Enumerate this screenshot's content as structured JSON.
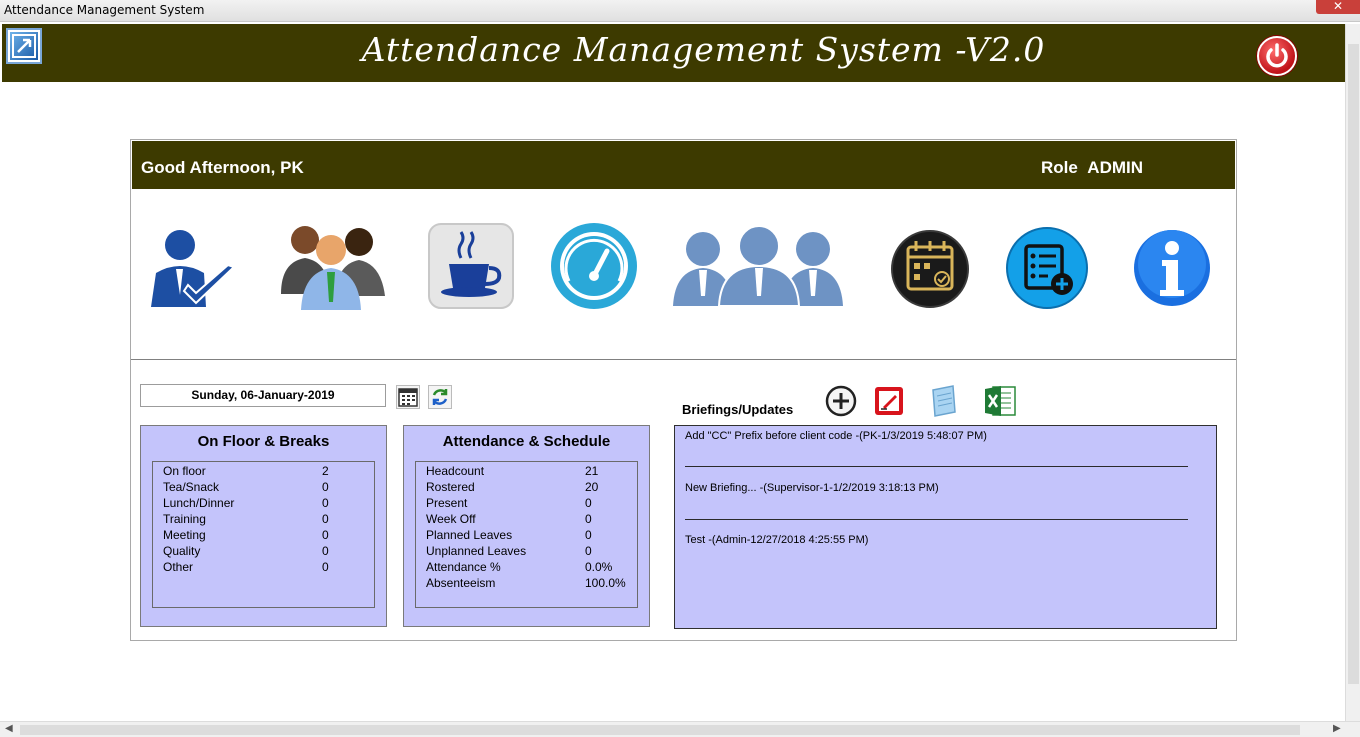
{
  "window": {
    "title": "Attendance Management System",
    "close_label": "✕"
  },
  "header": {
    "app_title": "Attendance Management System -V2.0"
  },
  "greeting_bar": {
    "greeting": "Good Afternoon, PK",
    "role_label": "Role",
    "role_value": "ADMIN"
  },
  "toolbar_icons": [
    "user-attendance-icon",
    "team-people-icon",
    "coffee-break-icon",
    "dashboard-gauge-icon",
    "employees-group-icon",
    "schedule-calendar-icon",
    "add-report-icon",
    "info-icon"
  ],
  "date": {
    "value": "Sunday,  06-January-2019"
  },
  "floor_breaks": {
    "title": "On Floor & Breaks",
    "rows": [
      {
        "label": "On floor",
        "value": "2"
      },
      {
        "label": "Tea/Snack",
        "value": "0"
      },
      {
        "label": "Lunch/Dinner",
        "value": "0"
      },
      {
        "label": "Training",
        "value": "0"
      },
      {
        "label": "Meeting",
        "value": "0"
      },
      {
        "label": "Quality",
        "value": "0"
      },
      {
        "label": "Other",
        "value": "0"
      }
    ]
  },
  "attendance_schedule": {
    "title": "Attendance & Schedule",
    "rows": [
      {
        "label": "Headcount",
        "value": "21"
      },
      {
        "label": "Rostered",
        "value": "20"
      },
      {
        "label": "Present",
        "value": "0"
      },
      {
        "label": "Week Off",
        "value": "0"
      },
      {
        "label": "Planned Leaves",
        "value": "0"
      },
      {
        "label": "Unplanned Leaves",
        "value": "0"
      },
      {
        "label": "Attendance %",
        "value": "0.0%"
      },
      {
        "label": "Absenteeism",
        "value": "100.0%"
      }
    ]
  },
  "briefings": {
    "label": "Briefings/Updates",
    "items": [
      "Add \"CC\" Prefix before client code  -(PK-1/3/2019 5:48:07 PM)",
      "New Briefing...  -(Supervisor-1-1/2/2019 3:18:13 PM)",
      "Test  -(Admin-12/27/2018 4:25:55 PM)"
    ]
  },
  "colors": {
    "header_bg": "#3d3a00",
    "box_bg": "#c4c4fb"
  }
}
